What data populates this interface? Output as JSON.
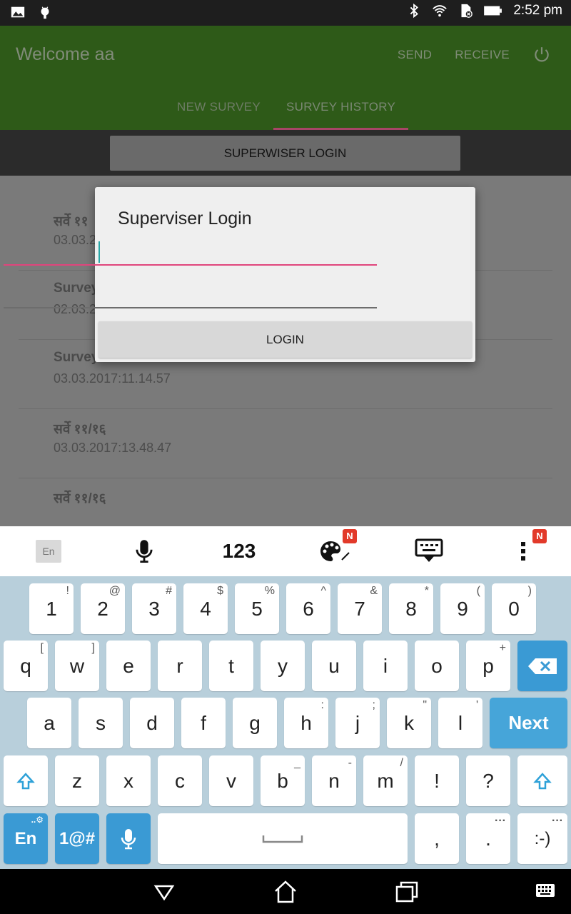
{
  "status_bar": {
    "time": "2:52 pm",
    "left_icons": [
      "image-icon",
      "android-icon"
    ],
    "right_icons": [
      "bluetooth-icon",
      "wifi-icon",
      "sim-off-icon",
      "battery-icon"
    ]
  },
  "app_bar": {
    "title": "Welcome aa",
    "send_label": "SEND",
    "receive_label": "RECEIVE",
    "power_icon": "power-icon",
    "tabs": [
      {
        "label": "NEW SURVEY",
        "active": false
      },
      {
        "label": "SURVEY HISTORY",
        "active": true
      }
    ]
  },
  "supervisor_button": "SUPERWISER LOGIN",
  "list": [
    {
      "title": "सर्वे ११",
      "date": "03.03.2"
    },
    {
      "title": "Survey",
      "date": "02.03.2"
    },
    {
      "title": "Survey 0",
      "date": "03.03.2017:11.14.57"
    },
    {
      "title": "सर्वे ११/१६",
      "date": "03.03.2017:13.48.47"
    },
    {
      "title": "सर्वे ११/१६",
      "date": ""
    }
  ],
  "dialog": {
    "title": "Superviser Login",
    "username_value": "",
    "password_value": "",
    "login_label": "LOGIN"
  },
  "keyboard_toolbar": {
    "lang_label": "En",
    "numbers_label": "123",
    "badge_label": "N",
    "icons": [
      "mic-icon",
      "palette-icon",
      "keyboard-hide-icon",
      "more-vert-icon"
    ]
  },
  "keyboard": {
    "row1": [
      {
        "k": "1",
        "s": "!"
      },
      {
        "k": "2",
        "s": "@"
      },
      {
        "k": "3",
        "s": "#"
      },
      {
        "k": "4",
        "s": "$"
      },
      {
        "k": "5",
        "s": "%"
      },
      {
        "k": "6",
        "s": "^"
      },
      {
        "k": "7",
        "s": "&"
      },
      {
        "k": "8",
        "s": "*"
      },
      {
        "k": "9",
        "s": "("
      },
      {
        "k": "0",
        "s": ")"
      }
    ],
    "row2": [
      {
        "k": "q",
        "s": "["
      },
      {
        "k": "w",
        "s": "]"
      },
      {
        "k": "e",
        "s": ""
      },
      {
        "k": "r",
        "s": ""
      },
      {
        "k": "t",
        "s": ""
      },
      {
        "k": "y",
        "s": ""
      },
      {
        "k": "u",
        "s": ""
      },
      {
        "k": "i",
        "s": ""
      },
      {
        "k": "o",
        "s": ""
      },
      {
        "k": "p",
        "s": "+"
      }
    ],
    "row3": [
      {
        "k": "a",
        "s": ""
      },
      {
        "k": "s",
        "s": ""
      },
      {
        "k": "d",
        "s": ""
      },
      {
        "k": "f",
        "s": ""
      },
      {
        "k": "g",
        "s": ""
      },
      {
        "k": "h",
        "s": ":"
      },
      {
        "k": "j",
        "s": ";"
      },
      {
        "k": "k",
        "s": "\""
      },
      {
        "k": "l",
        "s": "'"
      }
    ],
    "next_label": "Next",
    "row4": [
      {
        "k": "z",
        "s": ""
      },
      {
        "k": "x",
        "s": ""
      },
      {
        "k": "c",
        "s": ""
      },
      {
        "k": "v",
        "s": ""
      },
      {
        "k": "b",
        "s": "_"
      },
      {
        "k": "n",
        "s": "-"
      },
      {
        "k": "m",
        "s": "/"
      },
      {
        "k": "!",
        "s": ""
      },
      {
        "k": "?",
        "s": ""
      }
    ],
    "lang_key": "En",
    "symbols_key": "1@#",
    "comma_key": ",",
    "period_key": ".",
    "smiley_key": ":-)"
  },
  "nav_bar": {
    "icons": [
      "back-icon",
      "home-icon",
      "recents-icon",
      "keyboard-icon"
    ]
  }
}
